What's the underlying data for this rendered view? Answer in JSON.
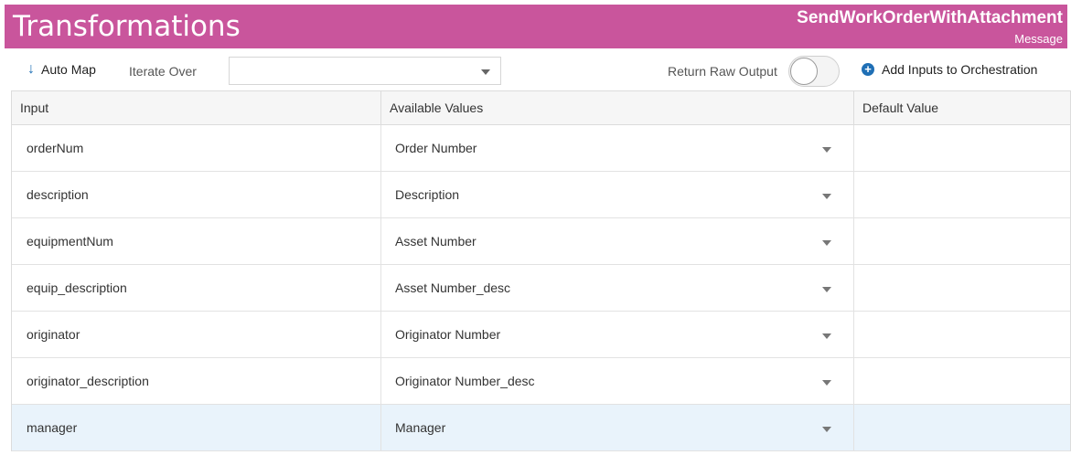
{
  "header": {
    "title": "Transformations",
    "object_name": "SendWorkOrderWithAttachment",
    "object_type": "Message"
  },
  "toolbar": {
    "auto_map_label": "Auto Map",
    "iterate_over_label": "Iterate Over",
    "iterate_over_value": "",
    "return_raw_output_label": "Return Raw Output",
    "return_raw_output_on": false,
    "add_inputs_label": "Add Inputs to Orchestration"
  },
  "colors": {
    "header_bg": "#c9559c",
    "accent": "#1f6fb5",
    "selected_row_bg": "#e9f3fb"
  },
  "grid": {
    "columns": [
      "Input",
      "Available Values",
      "Default Value"
    ],
    "rows": [
      {
        "input": "orderNum",
        "value": "Order Number",
        "default": ""
      },
      {
        "input": "description",
        "value": "Description",
        "default": ""
      },
      {
        "input": "equipmentNum",
        "value": "Asset Number",
        "default": ""
      },
      {
        "input": "equip_description",
        "value": "Asset Number_desc",
        "default": ""
      },
      {
        "input": "originator",
        "value": "Originator Number",
        "default": ""
      },
      {
        "input": "originator_description",
        "value": "Originator Number_desc",
        "default": ""
      },
      {
        "input": "manager",
        "value": "Manager",
        "default": ""
      }
    ],
    "selected_row": 6
  }
}
